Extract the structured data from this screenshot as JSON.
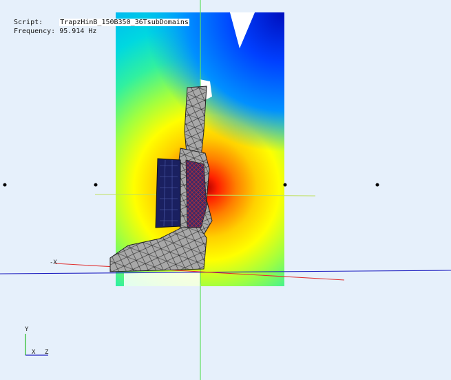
{
  "info": {
    "script_label": "Script:",
    "script_value": "TrapzHinB_150B350_36TsubDomains",
    "frequency_label": "Frequency:",
    "frequency_value": "95.914 Hz"
  },
  "axes": {
    "minus_x_label": "-X",
    "triad_y": "Y",
    "triad_x": "X",
    "triad_z": "Z"
  },
  "colors": {
    "background": "#e6f0fb",
    "axis_x": "#e03030",
    "axis_y": "#30d030",
    "axis_z": "#2020c0",
    "mesh_fill": "#a8a8a8",
    "mesh_edge": "#222222",
    "inner_dark": "#1a2060"
  }
}
